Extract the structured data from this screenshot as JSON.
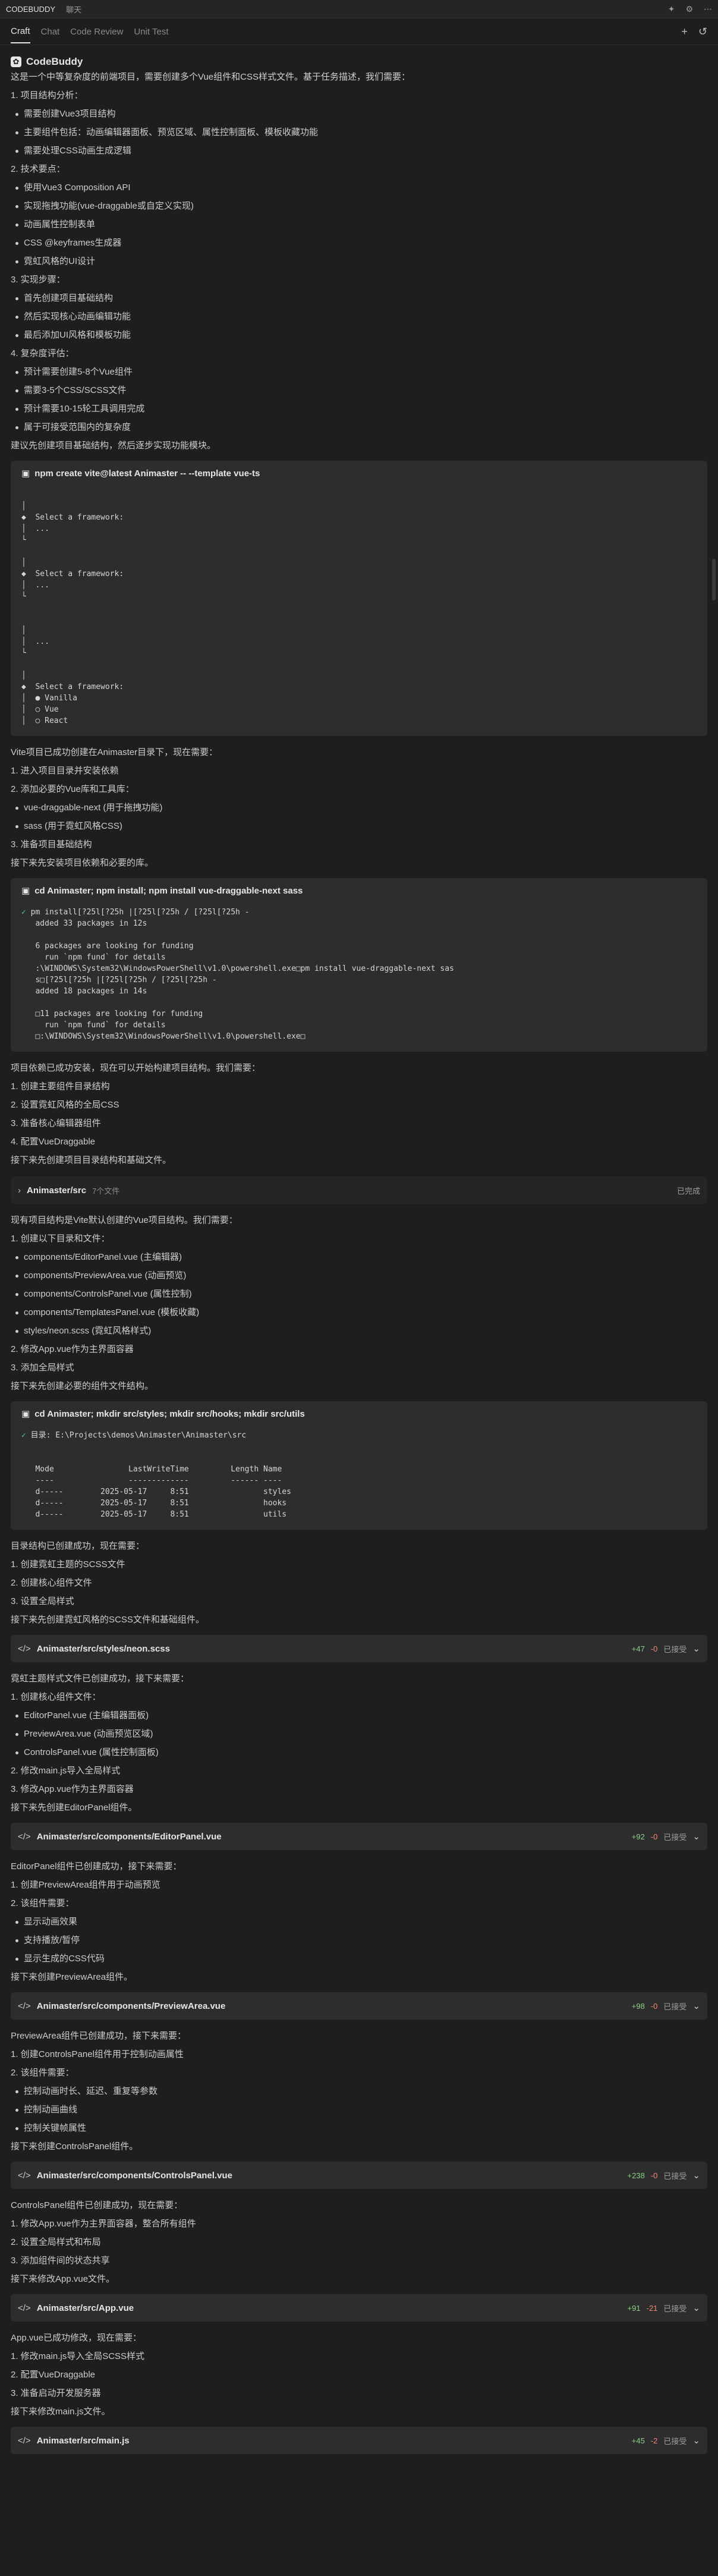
{
  "topbar": {
    "left_active": "CODEBUDDY",
    "left_other": "聊天",
    "icons": [
      "sparkle-icon",
      "settings-icon",
      "more-icon"
    ]
  },
  "tabs": {
    "items": [
      "Craft",
      "Chat",
      "Code Review",
      "Unit Test"
    ],
    "active": "Craft",
    "tools": [
      "plus-icon",
      "history-icon"
    ]
  },
  "brand": {
    "name": "CodeBuddy"
  },
  "intro": "这是一个中等复杂度的前端项目，需要创建多个Vue组件和CSS样式文件。基于任务描述，我们需要：",
  "analysis": [
    {
      "type": "line",
      "text": "1. 项目结构分析："
    },
    {
      "type": "bullet",
      "text": "需要创建Vue3项目结构"
    },
    {
      "type": "bullet",
      "text": "主要组件包括：动画编辑器面板、预览区域、属性控制面板、模板收藏功能"
    },
    {
      "type": "bullet",
      "text": "需要处理CSS动画生成逻辑"
    },
    {
      "type": "line",
      "text": "2. 技术要点："
    },
    {
      "type": "bullet",
      "text": "使用Vue3 Composition API"
    },
    {
      "type": "bullet",
      "text": "实现拖拽功能(vue-draggable或自定义实现)"
    },
    {
      "type": "bullet",
      "text": "动画属性控制表单"
    },
    {
      "type": "bullet",
      "text": "CSS @keyframes生成器"
    },
    {
      "type": "bullet",
      "text": "霓虹风格的UI设计"
    },
    {
      "type": "line",
      "text": "3. 实现步骤："
    },
    {
      "type": "bullet",
      "text": "首先创建项目基础结构"
    },
    {
      "type": "bullet",
      "text": "然后实现核心动画编辑功能"
    },
    {
      "type": "bullet",
      "text": "最后添加UI风格和模板功能"
    },
    {
      "type": "line",
      "text": "4. 复杂度评估："
    },
    {
      "type": "bullet",
      "text": "预计需要创建5-8个Vue组件"
    },
    {
      "type": "bullet",
      "text": "需要3-5个CSS/SCSS文件"
    },
    {
      "type": "bullet",
      "text": "预计需要10-15轮工具调用完成"
    },
    {
      "type": "bullet",
      "text": "属于可接受范围内的复杂度"
    },
    {
      "type": "line",
      "text": "建议先创建项目基础结构，然后逐步实现功能模块。"
    }
  ],
  "term1": {
    "cmd": "npm create vite@latest Animaster -- --template vue-ts",
    "lines": [
      "",
      "│",
      "◆  Select a framework:",
      "│  ...",
      "└",
      "",
      "│",
      "◆  Select a framework:",
      "│  ...",
      "└",
      "",
      "",
      "│",
      "│  ...",
      "└",
      "",
      "│",
      "◆  Select a framework:",
      "│  ● Vanilla",
      "│  ○ Vue",
      "│  ○ React"
    ]
  },
  "after1": [
    {
      "type": "line",
      "text": "Vite项目已成功创建在Animaster目录下，现在需要："
    },
    {
      "type": "line",
      "text": "1. 进入项目目录并安装依赖"
    },
    {
      "type": "line",
      "text": "2. 添加必要的Vue库和工具库："
    },
    {
      "type": "bullet",
      "text": "vue-draggable-next (用于拖拽功能)"
    },
    {
      "type": "bullet",
      "text": "sass (用于霓虹风格CSS)"
    },
    {
      "type": "line",
      "text": "3. 准备项目基础结构"
    },
    {
      "type": "line",
      "text": "接下来先安装项目依赖和必要的库。"
    }
  ],
  "term2": {
    "cmd": "cd Animaster; npm install; npm install vue-draggable-next sass",
    "lines": [
      "✓ pm install[?25l[?25h |[?25l[?25h / [?25l[?25h -",
      "   added 33 packages in 12s",
      "",
      "   6 packages are looking for funding",
      "     run `npm fund` for details",
      "   :\\WINDOWS\\System32\\WindowsPowerShell\\v1.0\\powershell.exe□pm install vue-draggable-next sas",
      "   s□[?25l[?25h |[?25l[?25h / [?25l[?25h -",
      "   added 18 packages in 14s",
      "",
      "   □11 packages are looking for funding",
      "     run `npm fund` for details",
      "   □:\\WINDOWS\\System32\\WindowsPowerShell\\v1.0\\powershell.exe□"
    ]
  },
  "after2": [
    {
      "type": "line",
      "text": "项目依赖已成功安装，现在可以开始构建项目结构。我们需要："
    },
    {
      "type": "line",
      "text": "1. 创建主要组件目录结构"
    },
    {
      "type": "line",
      "text": "2. 设置霓虹风格的全局CSS"
    },
    {
      "type": "line",
      "text": "3. 准备核心编辑器组件"
    },
    {
      "type": "line",
      "text": "4. 配置VueDraggable"
    },
    {
      "type": "line",
      "text": "接下来先创建项目目录结构和基础文件。"
    }
  ],
  "folder": {
    "name": "Animaster/src",
    "count": "7个文件",
    "status": "已完成"
  },
  "after3": [
    {
      "type": "line",
      "text": "现有项目结构是Vite默认创建的Vue项目结构。我们需要："
    },
    {
      "type": "line",
      "text": "1. 创建以下目录和文件："
    },
    {
      "type": "bullet",
      "text": "components/EditorPanel.vue (主编辑器)"
    },
    {
      "type": "bullet",
      "text": "components/PreviewArea.vue (动画预览)"
    },
    {
      "type": "bullet",
      "text": "components/ControlsPanel.vue (属性控制)"
    },
    {
      "type": "bullet",
      "text": "components/TemplatesPanel.vue (模板收藏)"
    },
    {
      "type": "bullet",
      "text": "styles/neon.scss (霓虹风格样式)"
    },
    {
      "type": "line",
      "text": "2. 修改App.vue作为主界面容器"
    },
    {
      "type": "line",
      "text": "3. 添加全局样式"
    },
    {
      "type": "line",
      "text": "接下来先创建必要的组件文件结构。"
    }
  ],
  "term3": {
    "cmd": "cd Animaster; mkdir src/styles; mkdir src/hooks; mkdir src/utils",
    "lines": [
      "✓ 目录: E:\\Projects\\demos\\Animaster\\Animaster\\src",
      "",
      "",
      "   Mode                LastWriteTime         Length Name",
      "   ----                -------------         ------ ----",
      "   d-----        2025-05-17     8:51                styles",
      "   d-----        2025-05-17     8:51                hooks",
      "   d-----        2025-05-17     8:51                utils"
    ]
  },
  "after4": [
    {
      "type": "line",
      "text": "目录结构已创建成功，现在需要："
    },
    {
      "type": "line",
      "text": "1. 创建霓虹主题的SCSS文件"
    },
    {
      "type": "line",
      "text": "2. 创建核心组件文件"
    },
    {
      "type": "line",
      "text": "3. 设置全局样式"
    },
    {
      "type": "line",
      "text": "接下来先创建霓虹风格的SCSS文件和基础组件。"
    }
  ],
  "file1": {
    "name": "Animaster/src/styles/neon.scss",
    "add": "+47",
    "del": "-0",
    "status": "已接受"
  },
  "after5": [
    {
      "type": "line",
      "text": "霓虹主题样式文件已创建成功，接下来需要："
    },
    {
      "type": "line",
      "text": "1. 创建核心组件文件："
    },
    {
      "type": "bullet",
      "text": "EditorPanel.vue (主编辑器面板)"
    },
    {
      "type": "bullet",
      "text": "PreviewArea.vue (动画预览区域)"
    },
    {
      "type": "bullet",
      "text": "ControlsPanel.vue (属性控制面板)"
    },
    {
      "type": "line",
      "text": "2. 修改main.js导入全局样式"
    },
    {
      "type": "line",
      "text": "3. 修改App.vue作为主界面容器"
    },
    {
      "type": "line",
      "text": "接下来先创建EditorPanel组件。"
    }
  ],
  "file2": {
    "name": "Animaster/src/components/EditorPanel.vue",
    "add": "+92",
    "del": "-0",
    "status": "已接受"
  },
  "after6": [
    {
      "type": "line",
      "text": "EditorPanel组件已创建成功，接下来需要："
    },
    {
      "type": "line",
      "text": "1. 创建PreviewArea组件用于动画预览"
    },
    {
      "type": "line",
      "text": "2. 该组件需要："
    },
    {
      "type": "bullet",
      "text": "显示动画效果"
    },
    {
      "type": "bullet",
      "text": "支持播放/暂停"
    },
    {
      "type": "bullet",
      "text": "显示生成的CSS代码"
    },
    {
      "type": "line",
      "text": "接下来创建PreviewArea组件。"
    }
  ],
  "file3": {
    "name": "Animaster/src/components/PreviewArea.vue",
    "add": "+98",
    "del": "-0",
    "status": "已接受"
  },
  "after7": [
    {
      "type": "line",
      "text": "PreviewArea组件已创建成功，接下来需要："
    },
    {
      "type": "line",
      "text": "1. 创建ControlsPanel组件用于控制动画属性"
    },
    {
      "type": "line",
      "text": "2. 该组件需要："
    },
    {
      "type": "bullet",
      "text": "控制动画时长、延迟、重复等参数"
    },
    {
      "type": "bullet",
      "text": "控制动画曲线"
    },
    {
      "type": "bullet",
      "text": "控制关键帧属性"
    },
    {
      "type": "line",
      "text": "接下来创建ControlsPanel组件。"
    }
  ],
  "file4": {
    "name": "Animaster/src/components/ControlsPanel.vue",
    "add": "+238",
    "del": "-0",
    "status": "已接受"
  },
  "after8": [
    {
      "type": "line",
      "text": "ControlsPanel组件已创建成功，现在需要："
    },
    {
      "type": "line",
      "text": "1. 修改App.vue作为主界面容器，整合所有组件"
    },
    {
      "type": "line",
      "text": "2. 设置全局样式和布局"
    },
    {
      "type": "line",
      "text": "3. 添加组件间的状态共享"
    },
    {
      "type": "line",
      "text": "接下来修改App.vue文件。"
    }
  ],
  "file5": {
    "name": "Animaster/src/App.vue",
    "add": "+91",
    "del": "-21",
    "status": "已接受"
  },
  "after9": [
    {
      "type": "line",
      "text": "App.vue已成功修改，现在需要："
    },
    {
      "type": "line",
      "text": "1. 修改main.js导入全局SCSS样式"
    },
    {
      "type": "line",
      "text": "2. 配置VueDraggable"
    },
    {
      "type": "line",
      "text": "3. 准备启动开发服务器"
    },
    {
      "type": "line",
      "text": "接下来修改main.js文件。"
    }
  ],
  "file6": {
    "name": "Animaster/src/main.js",
    "add": "+45",
    "del": "-2",
    "status": "已接受"
  }
}
